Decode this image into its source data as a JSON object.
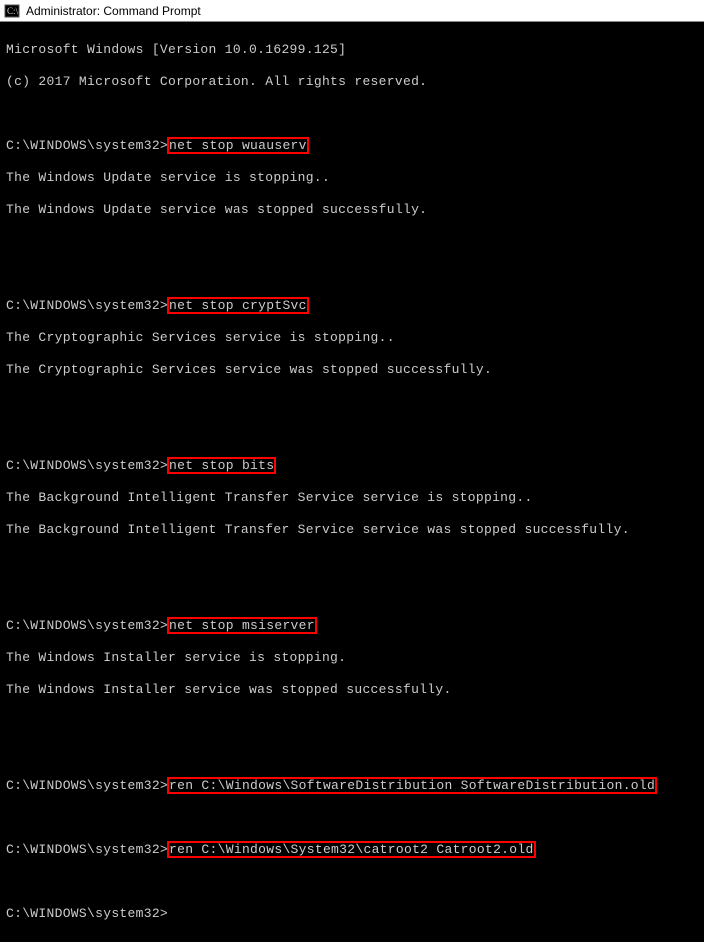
{
  "titlebar": {
    "title": "Administrator: Command Prompt"
  },
  "terminal": {
    "banner1": "Microsoft Windows [Version 10.0.16299.125]",
    "banner2": "(c) 2017 Microsoft Corporation. All rights reserved.",
    "prompt": "C:\\WINDOWS\\system32>",
    "commands": {
      "cmd1": "net stop wuauserv",
      "cmd1_out1": "The Windows Update service is stopping..",
      "cmd1_out2": "The Windows Update service was stopped successfully.",
      "cmd2": "net stop cryptSvc",
      "cmd2_out1": "The Cryptographic Services service is stopping..",
      "cmd2_out2": "The Cryptographic Services service was stopped successfully.",
      "cmd3": "net stop bits",
      "cmd3_out1": "The Background Intelligent Transfer Service service is stopping..",
      "cmd3_out2": "The Background Intelligent Transfer Service service was stopped successfully.",
      "cmd4": "net stop msiserver",
      "cmd4_out1": "The Windows Installer service is stopping.",
      "cmd4_out2": "The Windows Installer service was stopped successfully.",
      "cmd5": "ren C:\\Windows\\SoftwareDistribution SoftwareDistribution.old",
      "cmd6": "ren C:\\Windows\\System32\\catroot2 Catroot2.old"
    }
  }
}
